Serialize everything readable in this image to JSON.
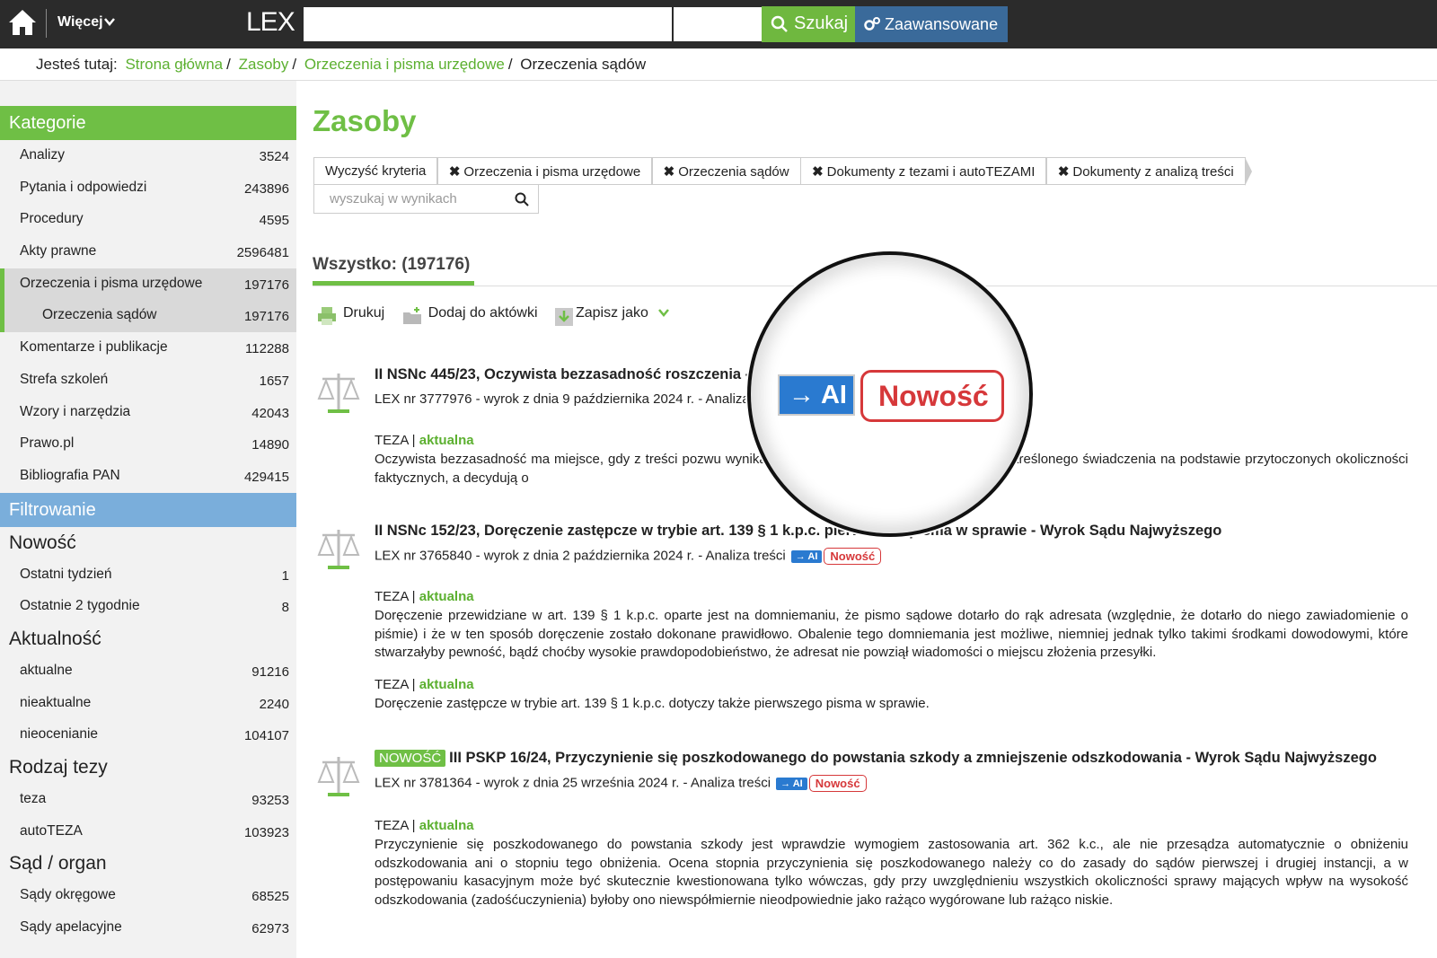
{
  "topbar": {
    "more_label": "Więcej",
    "logo": "LEX",
    "search_button": "Szukaj",
    "advanced_button": "Zaawansowane"
  },
  "breadcrumb": {
    "prefix": "Jesteś tutaj:",
    "items": [
      "Strona główna",
      "Zasoby",
      "Orzeczenia i pisma urzędowe",
      "Orzeczenia sądów"
    ],
    "separator": "/"
  },
  "sidebar": {
    "categories_title": "Kategorie",
    "categories": [
      {
        "label": "Analizy",
        "count": "3524"
      },
      {
        "label": "Pytania i odpowiedzi",
        "count": "243896"
      },
      {
        "label": "Procedury",
        "count": "4595"
      },
      {
        "label": "Akty prawne",
        "count": "2596481"
      },
      {
        "label": "Orzeczenia i pisma urzędowe",
        "count": "197176"
      },
      {
        "label": "Orzeczenia sądów",
        "count": "197176"
      },
      {
        "label": "Komentarze i publikacje",
        "count": "112288"
      },
      {
        "label": "Strefa szkoleń",
        "count": "1657"
      },
      {
        "label": "Wzory i narzędzia",
        "count": "42043"
      },
      {
        "label": "Prawo.pl",
        "count": "14890"
      },
      {
        "label": "Bibliografia PAN",
        "count": "429415"
      }
    ],
    "filter_title": "Filtrowanie",
    "groups": [
      {
        "title": "Nowość",
        "items": [
          {
            "label": "Ostatni tydzień",
            "count": "1"
          },
          {
            "label": "Ostatnie 2 tygodnie",
            "count": "8"
          }
        ]
      },
      {
        "title": "Aktualność",
        "items": [
          {
            "label": "aktualne",
            "count": "91216"
          },
          {
            "label": "nieaktualne",
            "count": "2240"
          },
          {
            "label": "nieocenianie",
            "count": "104107"
          }
        ]
      },
      {
        "title": "Rodzaj tezy",
        "items": [
          {
            "label": "teza",
            "count": "93253"
          },
          {
            "label": "autoTEZA",
            "count": "103923"
          }
        ]
      },
      {
        "title": "Sąd / organ",
        "items": [
          {
            "label": "Sądy okręgowe",
            "count": "68525"
          },
          {
            "label": "Sądy apelacyjne",
            "count": "62973"
          }
        ]
      }
    ]
  },
  "main": {
    "title": "Zasoby",
    "chips": [
      "Wyczyść kryteria",
      "Orzeczenia i pisma urzędowe",
      "Orzeczenia sądów",
      "Dokumenty z tezami i autoTEZAMI",
      "Dokumenty z analizą treści"
    ],
    "chip_remove_symbol": "✖",
    "filter_placeholder": "wyszukaj w wynikach",
    "all_label": "Wszystko: (197176)",
    "tools": [
      "Drukuj",
      "Dodaj do aktówki",
      "Zapisz jako"
    ]
  },
  "results": [
    {
      "title": "II NSNc 445/23, Oczywista bezzasadność roszczenia - W",
      "meta": "LEX nr 3777976 - wyrok z dnia 9 października 2024 r. - Analiza",
      "tezy": [
        {
          "label": "TEZA",
          "status": "aktualna",
          "text": "Oczywista bezzasadność ma miejsce, gdy z treści pozwu wynika ... wało prawo żądania od pozwanego określonego świadczenia na podstawie przytoczonych okoliczności faktycznych, a decydują o"
        }
      ]
    },
    {
      "title": "II NSNc 152/23, Doręczenie zastępcze w trybie art. 139 § 1 k.p.c. pierwszego pisma w sprawie - Wyrok Sądu Najwyższego",
      "meta": "LEX nr 3765840 - wyrok z dnia 2 października 2024 r. - Analiza treści",
      "tezy": [
        {
          "label": "TEZA",
          "status": "aktualna",
          "text": "Doręczenie przewidziane w art. 139 § 1 k.p.c. oparte jest na domniemaniu, że pismo sądowe dotarło do rąk adresata (względnie, że dotarło do niego zawiadomienie o piśmie) i że w ten sposób doręczenie zostało dokonane prawidłowo. Obalenie tego domniemania jest możliwe, niemniej jednak tylko takimi środkami dowodowymi, które stwarzałyby pewność, bądź choćby wysokie prawdopodobieństwo, że adresat nie powziął wiadomości o miejscu złożenia przesyłki."
        },
        {
          "label": "TEZA",
          "status": "aktualna",
          "text": "Doręczenie zastępcze w trybie art. 139 § 1 k.p.c. dotyczy także pierwszego pisma w sprawie."
        }
      ]
    },
    {
      "tag": "NOWOŚĆ",
      "title": "III PSKP 16/24, Przyczynienie się poszkodowanego do powstania szkody a zmniejszenie odszkodowania - Wyrok Sądu Najwyższego",
      "meta": "LEX nr 3781364 - wyrok z dnia 25 września 2024 r. - Analiza treści",
      "tezy": [
        {
          "label": "TEZA",
          "status": "aktualna",
          "text": "Przyczynienie się poszkodowanego do powstania szkody jest wprawdzie wymogiem zastosowania art. 362 k.c., ale nie przesądza automatycznie o obniżeniu odszkodowania ani o stopniu tego obniżenia. Ocena stopnia przyczynienia się poszkodowanego należy co do zasady do sądów pierwszej i drugiej instancji, a w postępowaniu kasacyjnym może być skutecznie kwestionowana tylko wówczas, gdy przy uwzględnieniu wszystkich okoliczności sprawy mających wpływ na wysokość odszkodowania (zadośćuczynienia) byłoby ono niewspółmiernie nieodpowiednie jako rażąco wygórowane lub rażąco niskie."
        }
      ]
    }
  ],
  "badges": {
    "ai": "→ AI",
    "new": "Nowość"
  },
  "colors": {
    "green": "#6fbf45",
    "blue": "#7aaedb",
    "ai_blue": "#2a7ad0",
    "red": "#d6383a",
    "topbar": "#2b2b2b"
  }
}
